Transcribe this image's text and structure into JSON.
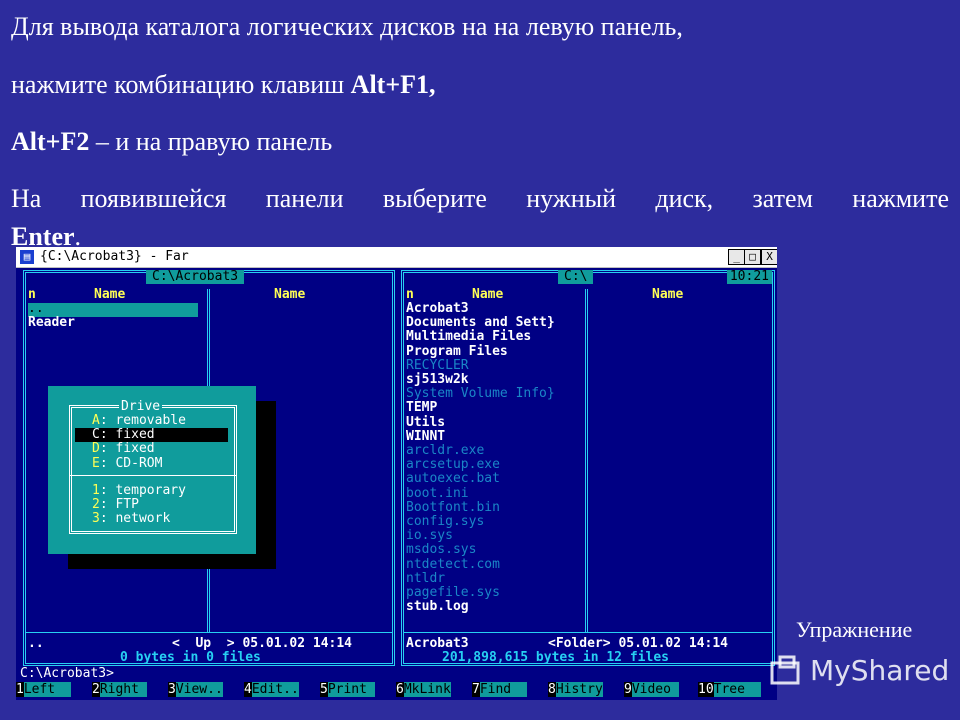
{
  "slide": {
    "line1": "Для вывода каталога логических дисков на на левую панель,",
    "line2_pre": "нажмите комбинацию клавиш ",
    "line2_bold": "Alt+F1,",
    "line3_bold": "Alt+F2",
    "line3_rest": " – и на правую панель",
    "line4": "На появившейся панели выберите нужный диск, затем нажмите",
    "line5_bold": "Enter",
    "line5_rest": "."
  },
  "window": {
    "title": "{C:\\Acrobat3} - Far",
    "min_btn": "_",
    "max_btn": "□",
    "close_btn": "X"
  },
  "left_panel": {
    "title": "C:\\Acrobat3",
    "col1_n": "n",
    "col1_name": "Name",
    "col2_name": "Name",
    "items": [
      "..",
      "Reader"
    ],
    "status_name": "..",
    "status_info": "<  Up  > 05.01.02 14:14",
    "summary": "0 bytes in 0 files"
  },
  "right_panel": {
    "title": "C:\\",
    "clock": "10:21",
    "col1_n": "n",
    "col1_name": "Name",
    "col2_name": "Name",
    "items": [
      {
        "name": "Acrobat3",
        "style": "white"
      },
      {
        "name": "Documents and Sett}",
        "style": "white"
      },
      {
        "name": "Multimedia Files",
        "style": "white"
      },
      {
        "name": "Program Files",
        "style": "white"
      },
      {
        "name": "RECYCLER",
        "style": "dim"
      },
      {
        "name": "sj513w2k",
        "style": "white"
      },
      {
        "name": "System Volume Info}",
        "style": "dim"
      },
      {
        "name": "TEMP",
        "style": "white"
      },
      {
        "name": "Utils",
        "style": "white"
      },
      {
        "name": "WINNT",
        "style": "white"
      },
      {
        "name": "arcldr.exe",
        "style": "dim"
      },
      {
        "name": "arcsetup.exe",
        "style": "dim"
      },
      {
        "name": "autoexec.bat",
        "style": "dim"
      },
      {
        "name": "boot.ini",
        "style": "dim"
      },
      {
        "name": "Bootfont.bin",
        "style": "dim"
      },
      {
        "name": "config.sys",
        "style": "dim"
      },
      {
        "name": "io.sys",
        "style": "dim"
      },
      {
        "name": "msdos.sys",
        "style": "dim"
      },
      {
        "name": "ntdetect.com",
        "style": "dim"
      },
      {
        "name": "ntldr",
        "style": "dim"
      },
      {
        "name": "pagefile.sys",
        "style": "dim"
      },
      {
        "name": "stub.log",
        "style": "white"
      }
    ],
    "status_name": "Acrobat3",
    "status_info": "<Folder> 05.01.02 14:14",
    "summary": "201,898,615 bytes in 12 files"
  },
  "drive_menu": {
    "title": "Drive",
    "items": [
      {
        "key": "A",
        "label": ": removable"
      },
      {
        "key": "C",
        "label": ": fixed",
        "selected": true
      },
      {
        "key": "D",
        "label": ": fixed"
      },
      {
        "key": "E",
        "label": ": CD-ROM"
      },
      {
        "key": "1",
        "label": ": temporary"
      },
      {
        "key": "2",
        "label": ": FTP"
      },
      {
        "key": "3",
        "label": ": network"
      }
    ]
  },
  "command_line": "C:\\Acrobat3>",
  "keybar": [
    {
      "num": "1",
      "label": "Left"
    },
    {
      "num": "2",
      "label": "Right"
    },
    {
      "num": "3",
      "label": "View.."
    },
    {
      "num": "4",
      "label": "Edit.."
    },
    {
      "num": "5",
      "label": "Print"
    },
    {
      "num": "6",
      "label": "MkLink"
    },
    {
      "num": "7",
      "label": "Find"
    },
    {
      "num": "8",
      "label": "Histry"
    },
    {
      "num": "9",
      "label": "Video"
    },
    {
      "num": "10",
      "label": "Tree"
    }
  ],
  "caption": "Упражнение",
  "watermark": "MyShared",
  "colors": {
    "slide_bg": "#2d2c9d",
    "far_bg": "#000084",
    "frame": "#27d0f2",
    "teal": "#109c9c",
    "header_yellow": "#ffff55"
  }
}
